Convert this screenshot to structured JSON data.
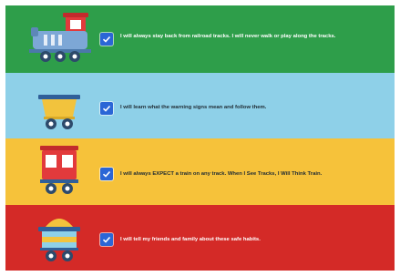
{
  "pledges": [
    {
      "text": "I will always stay back from railroad tracks. I will never walk or play along the tracks.",
      "checked": true,
      "icon": "train-engine-icon",
      "background": "#2e9e4a"
    },
    {
      "text": "I will learn what the warning signs mean and follow them.",
      "checked": true,
      "icon": "open-cart-icon",
      "background": "#8ed0e8"
    },
    {
      "text": "I will always EXPECT a train on any track. When I See Tracks, I Will Think Train.",
      "checked": true,
      "icon": "passenger-car-icon",
      "background": "#f6c23a"
    },
    {
      "text": "I will tell my friends and family about these safe habits.",
      "checked": true,
      "icon": "cargo-cart-icon",
      "background": "#d42a27"
    }
  ],
  "colors": {
    "checkbox": "#2b66d6"
  }
}
